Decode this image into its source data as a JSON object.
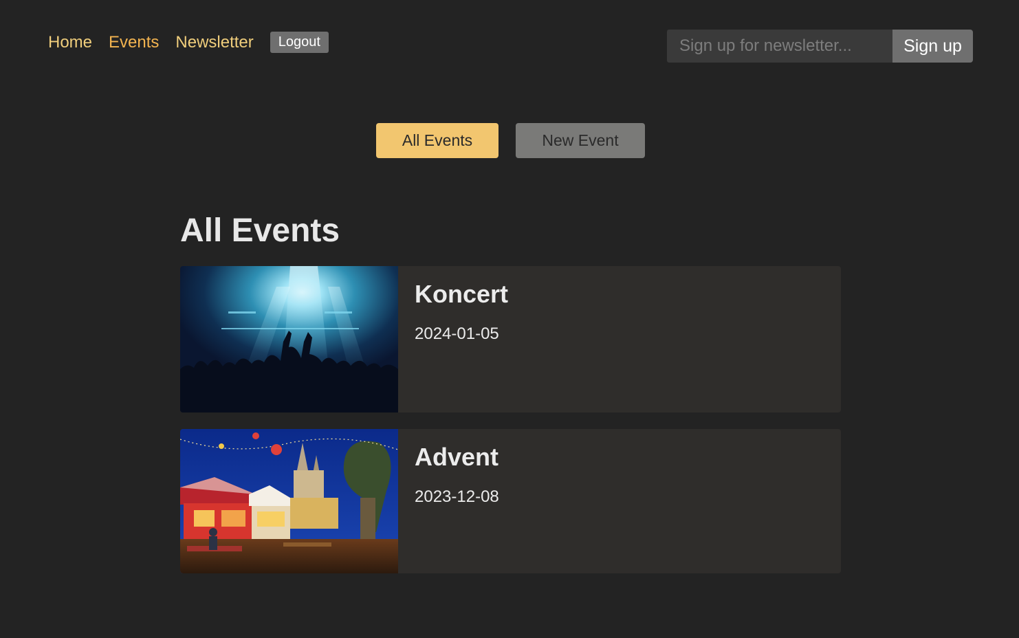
{
  "nav": {
    "items": [
      {
        "label": "Home"
      },
      {
        "label": "Events"
      },
      {
        "label": "Newsletter"
      }
    ],
    "logout_label": "Logout"
  },
  "newsletter": {
    "placeholder": "Sign up for newsletter...",
    "value": "",
    "button_label": "Sign up"
  },
  "subnav": {
    "all_events_label": "All Events",
    "new_event_label": "New Event"
  },
  "main": {
    "title": "All Events",
    "events": [
      {
        "title": "Koncert",
        "date": "2024-01-05",
        "image_icon": "concert-photo"
      },
      {
        "title": "Advent",
        "date": "2023-12-08",
        "image_icon": "advent-market-photo"
      }
    ]
  },
  "colors": {
    "background": "#232323",
    "nav_link": "#f0ce7c",
    "nav_link_active": "#f3b450",
    "primary_button": "#f2c66f",
    "secondary_button": "#7a7a78",
    "card_background": "#2f2d2b"
  }
}
